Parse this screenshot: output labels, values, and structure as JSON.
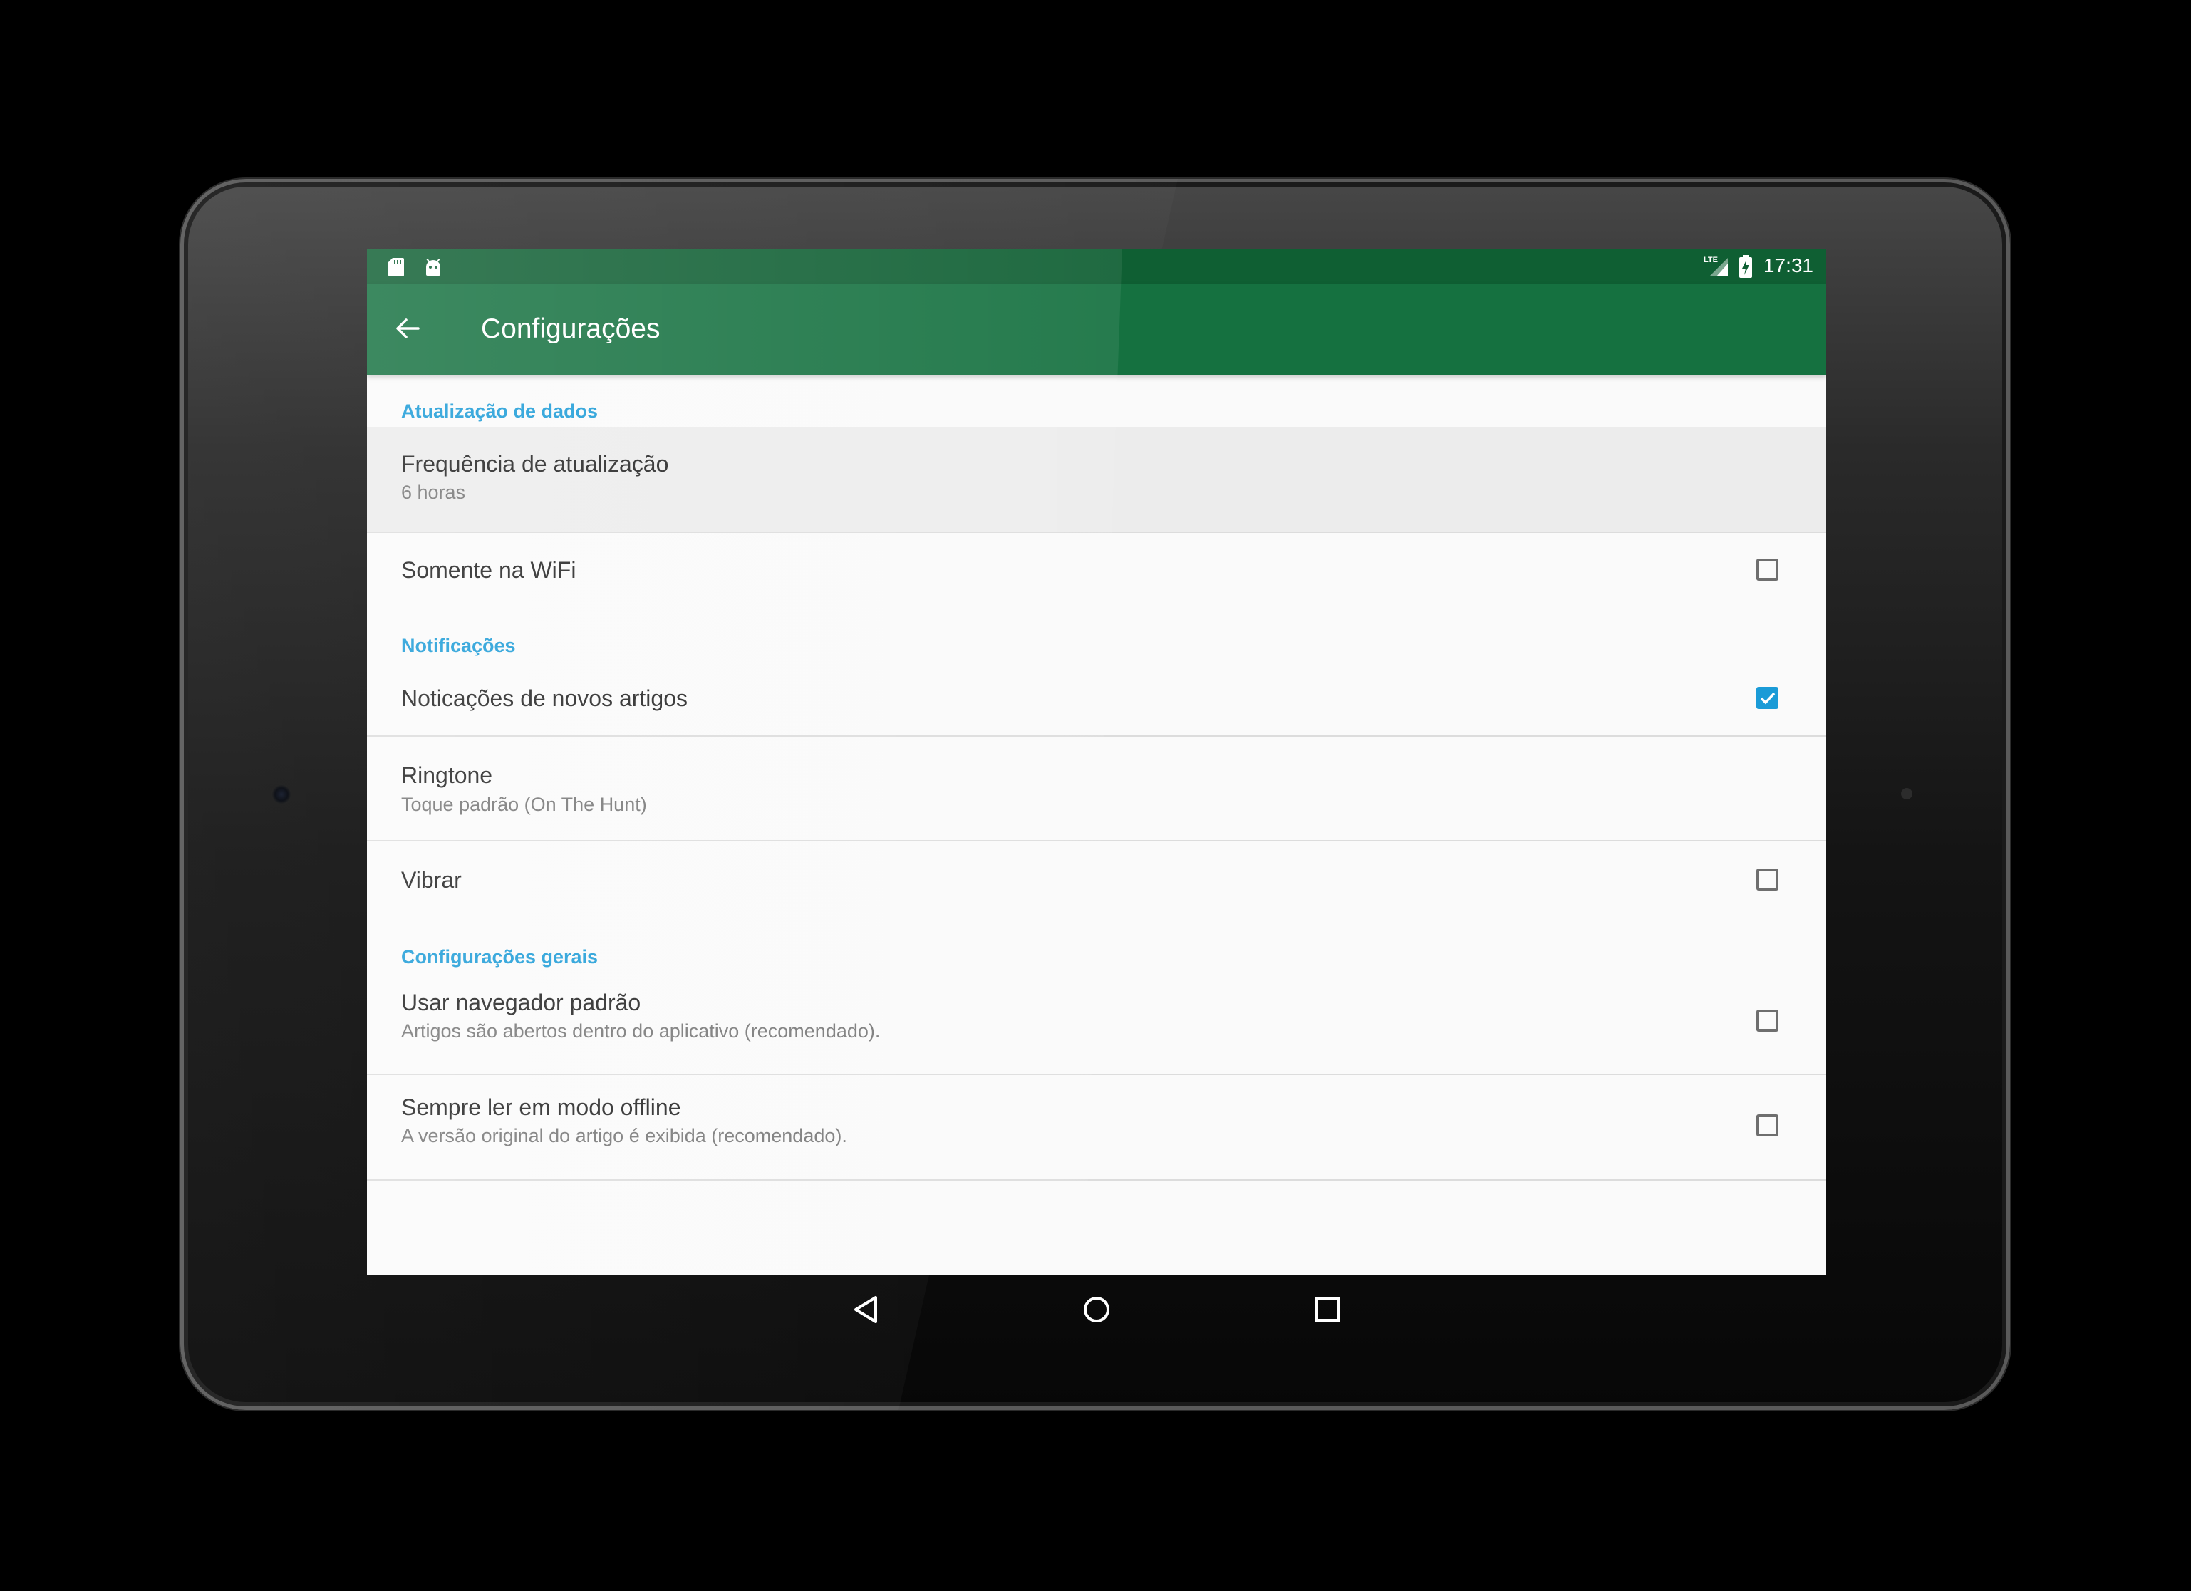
{
  "status_bar": {
    "time": "17:31",
    "left_icons": [
      "sd-card-icon",
      "android-icon"
    ],
    "right_icons": [
      "lte-signal-icon",
      "battery-charging-icon"
    ]
  },
  "app_bar": {
    "title": "Configurações",
    "back_icon": "arrow-back-icon"
  },
  "sections": [
    {
      "header": "Atualização de dados",
      "items": [
        {
          "title": "Frequência de atualização",
          "summary": "6 horas",
          "type": "list",
          "highlighted": true
        },
        {
          "title": "Somente na WiFi",
          "type": "checkbox",
          "checked": false
        }
      ]
    },
    {
      "header": "Notificações",
      "items": [
        {
          "title": "Noticações de novos artigos",
          "type": "checkbox",
          "checked": true
        },
        {
          "title": "Ringtone",
          "summary": "Toque padrão (On The Hunt)",
          "type": "ringtone"
        },
        {
          "title": "Vibrar",
          "type": "checkbox",
          "checked": false
        }
      ]
    },
    {
      "header": "Configurações gerais",
      "items": [
        {
          "title": "Usar navegador padrão",
          "summary": "Artigos são abertos dentro do aplicativo (recomendado).",
          "type": "checkbox",
          "checked": false
        },
        {
          "title": "Sempre ler em modo offline",
          "summary": "A versão original do artigo é exibida (recomendado).",
          "type": "checkbox",
          "checked": false
        }
      ]
    }
  ],
  "nav_bar": {
    "buttons": [
      "back-triangle-icon",
      "home-circle-icon",
      "recents-square-icon"
    ]
  },
  "colors": {
    "status_bar": "#0f5f33",
    "app_bar": "#157140",
    "accent": "#1a9bd7",
    "background": "#fafafa"
  }
}
